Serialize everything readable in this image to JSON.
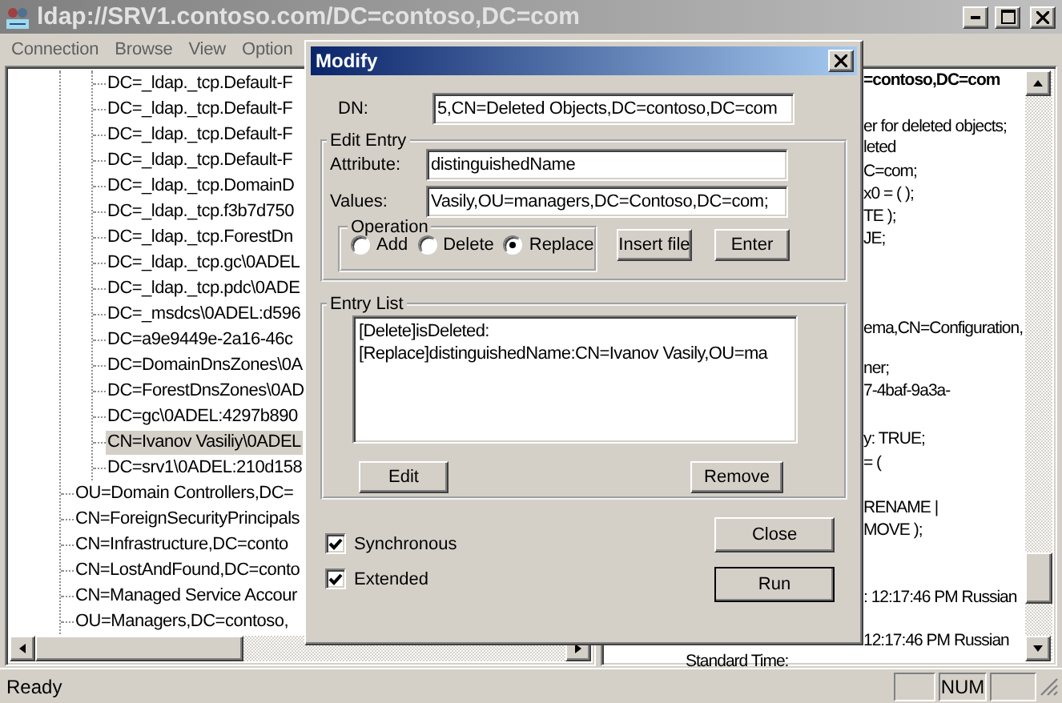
{
  "window": {
    "title": "ldap://SRV1.contoso.com/DC=contoso,DC=com"
  },
  "menu": [
    "Connection",
    "Browse",
    "View",
    "Option"
  ],
  "tree": {
    "items": [
      {
        "children": [
          {
            "label": "DC=_ldap._tcp.Default-F",
            "selected": false
          },
          {
            "label": "DC=_ldap._tcp.Default-F",
            "selected": false
          },
          {
            "label": "DC=_ldap._tcp.Default-F",
            "selected": false
          },
          {
            "label": "DC=_ldap._tcp.Default-F",
            "selected": false
          },
          {
            "label": "DC=_ldap._tcp.DomainD",
            "selected": false
          },
          {
            "label": "DC=_ldap._tcp.f3b7d750",
            "selected": false
          },
          {
            "label": "DC=_ldap._tcp.ForestDn",
            "selected": false
          },
          {
            "label": "DC=_ldap._tcp.gc\\0ADEL",
            "selected": false
          },
          {
            "label": "DC=_ldap._tcp.pdc\\0ADE",
            "selected": false
          },
          {
            "label": "DC=_msdcs\\0ADEL:d596",
            "selected": false
          },
          {
            "label": "DC=a9e9449e-2a16-46c",
            "selected": false
          },
          {
            "label": "DC=DomainDnsZones\\0A",
            "selected": false
          },
          {
            "label": "DC=ForestDnsZones\\0AD",
            "selected": false
          },
          {
            "label": "DC=gc\\0ADEL:4297b890",
            "selected": false
          },
          {
            "label": "CN=Ivanov Vasiliy\\0ADEL",
            "selected": true
          },
          {
            "label": "DC=srv1\\0ADEL:210d158",
            "selected": false
          }
        ]
      },
      {
        "label": "OU=Domain Controllers,DC=",
        "selected": false
      },
      {
        "label": "CN=ForeignSecurityPrincipals",
        "selected": false
      },
      {
        "label": "CN=Infrastructure,DC=conto",
        "selected": false
      },
      {
        "label": "CN=LostAndFound,DC=conto",
        "selected": false
      },
      {
        "label": "CN=Managed Service Accour",
        "selected": false
      },
      {
        "label": "OU=Managers,DC=contoso,",
        "selected": false
      }
    ]
  },
  "details": [
    {
      "kind": "heading",
      "text": "=contoso,DC=com"
    },
    {
      "kind": "text",
      "text": "er for deleted objects;"
    },
    {
      "kind": "text",
      "text": "leted"
    },
    {
      "kind": "text",
      "text": "C=com;"
    },
    {
      "kind": "text",
      "text": "x0 = (  );"
    },
    {
      "kind": "text",
      "text": "TE );"
    },
    {
      "kind": "text",
      "text": "JE;"
    },
    {
      "kind": "text",
      "text": "ema,CN=Configuration,"
    },
    {
      "kind": "text",
      "text": "ner;"
    },
    {
      "kind": "text",
      "text": "7-4baf-9a3a-"
    },
    {
      "kind": "text",
      "text": "y: TRUE;"
    },
    {
      "kind": "text",
      "text": "= ("
    },
    {
      "kind": "text",
      "text": "RENAME |"
    },
    {
      "kind": "text",
      "text": "MOVE );"
    },
    {
      "kind": "text",
      "text": ": 12:17:46 PM Russian"
    },
    {
      "kind": "text",
      "text": "12:17:46 PM Russian"
    },
    {
      "kind": "wrapped",
      "text": "Standard Time:"
    }
  ],
  "dialog": {
    "title": "Modify",
    "dn": {
      "label": "DN:",
      "value": "5,CN=Deleted Objects,DC=contoso,DC=com"
    },
    "edit_entry": {
      "title": "Edit Entry",
      "attribute": {
        "label": "Attribute:",
        "value": "distinguishedName"
      },
      "values": {
        "label": "Values:",
        "value": "Vasily,OU=managers,DC=Contoso,DC=com;"
      },
      "operation": {
        "title": "Operation",
        "options": [
          {
            "label": "Add",
            "selected": false
          },
          {
            "label": "Delete",
            "selected": false
          },
          {
            "label": "Replace",
            "selected": true
          }
        ]
      },
      "buttons": [
        "Insert file",
        "Enter"
      ]
    },
    "entry_list": {
      "title": "Entry List",
      "entries": [
        "[Delete]isDeleted:",
        "[Replace]distinguishedName:CN=Ivanov Vasily,OU=ma"
      ],
      "buttons": [
        "Edit",
        "Remove"
      ]
    },
    "options": [
      {
        "label": "Synchronous",
        "checked": true
      },
      {
        "label": "Extended",
        "checked": true
      }
    ],
    "buttons": [
      {
        "label": "Close",
        "default": false
      },
      {
        "label": "Run",
        "default": true
      }
    ]
  },
  "status_bar": {
    "text": "Ready",
    "indicators": [
      "NUM"
    ]
  }
}
